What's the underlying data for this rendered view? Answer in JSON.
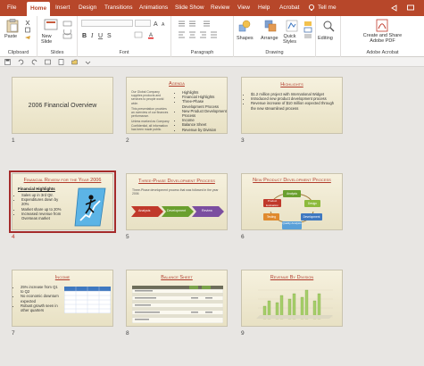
{
  "tabs": [
    "File",
    "Home",
    "Insert",
    "Design",
    "Transitions",
    "Animations",
    "Slide Show",
    "Review",
    "View",
    "Help",
    "Acrobat"
  ],
  "tell_me": "Tell me",
  "ribbon": {
    "paste": "Paste",
    "new_slide": "New\nSlide",
    "shapes": "Shapes",
    "arrange": "Arrange",
    "quick_styles": "Quick\nStyles",
    "editing": "Editing",
    "create_share": "Create and Share\nAdobe PDF",
    "groups": {
      "clipboard": "Clipboard",
      "slides": "Slides",
      "font": "Font",
      "paragraph": "Paragraph",
      "drawing": "Drawing",
      "adobe": "Adobe Acrobat"
    }
  },
  "colors": {
    "accent": "#b7472a",
    "selected_border": "#a52b2b",
    "slide_bg": "#f2ecd6"
  },
  "slides": [
    {
      "num": "1",
      "title": "2006 Financial Overview"
    },
    {
      "num": "2",
      "title": "Agenda",
      "para": [
        "Our Global Company",
        "supplies products and",
        "services to people world",
        "wide.",
        "",
        "This presentation provides",
        "an overview of our finances",
        "performance.",
        "",
        "Unless marked as Company",
        "Confidential, all information",
        "has been made public."
      ],
      "bullets": [
        "Highlights",
        "Financial Highlights",
        "Three-Phase Development Process",
        "New Product Development Process",
        "Income",
        "Balance Sheet",
        "Revenue by Division"
      ]
    },
    {
      "num": "3",
      "title": "Highlights",
      "bullets": [
        "$1.2 million project with International Widget",
        "Introduced new product development process",
        "Revenue increase of $10 million expected through the new streamlined process"
      ]
    },
    {
      "num": "4",
      "title": "Financial Review for the Year 2006",
      "subtitle": "Financial Highlights",
      "bullets": [
        "Sales up in 3rd Qtr.",
        "Expenditures down by 20%",
        "Market share up to 20%",
        "Increased revenue from Overseas market"
      ]
    },
    {
      "num": "5",
      "title": "Three-Phase Development Process",
      "para": [
        "Three-Phase development process that was followed in the year 2006"
      ],
      "steps": [
        "Analysis",
        "Development",
        "Review"
      ]
    },
    {
      "num": "6",
      "title": "New Product Development Process",
      "cycle": [
        "Analysis",
        "Design",
        "Development",
        "Quality Analysis",
        "Testing",
        "Product Evaluation"
      ]
    },
    {
      "num": "7",
      "title": "Income",
      "bullets": [
        "25% increase from Q1 to Q2",
        "No economic downturn expected",
        "Robust growth seen in other quarters"
      ]
    },
    {
      "num": "8",
      "title": "Balance Sheet"
    },
    {
      "num": "9",
      "title": "Revenue By Division"
    }
  ]
}
